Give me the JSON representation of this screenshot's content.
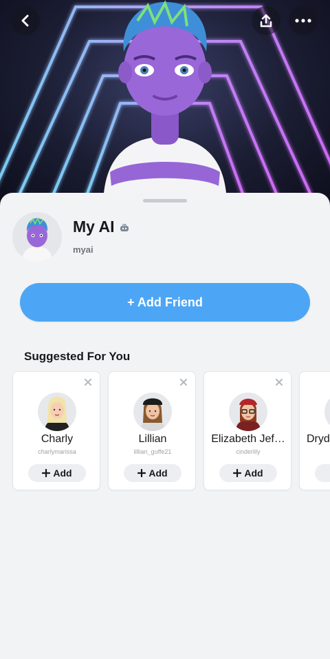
{
  "header": {
    "back_icon": "back-chevron-icon",
    "share_icon": "share-upload-icon",
    "more_icon": "more-dots-icon"
  },
  "profile": {
    "name": "My AI",
    "badge_icon": "ai-bot-icon",
    "username": "myai"
  },
  "actions": {
    "add_friend_label": "+ Add Friend",
    "accent_color": "#4ca6f5"
  },
  "suggested": {
    "title": "Suggested For You",
    "add_label": "Add",
    "items": [
      {
        "name": "Charly",
        "username": "charlymarissa"
      },
      {
        "name": "Lillian",
        "username": "lillian_guffe21"
      },
      {
        "name": "Elizabeth Jef…",
        "username": "cinderlily"
      },
      {
        "name": "Dryd",
        "username": ""
      }
    ]
  }
}
